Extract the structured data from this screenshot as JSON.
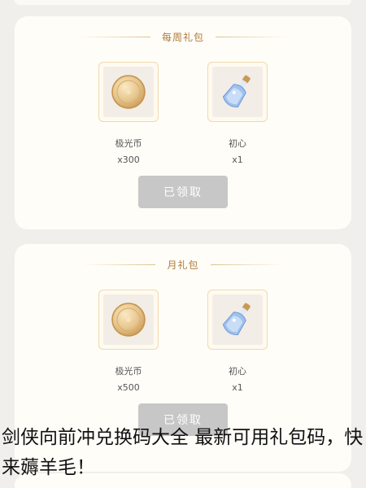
{
  "colors": {
    "background": "#f1efec",
    "card": "#fffdf8",
    "title_gold": "#b07a3a",
    "button_disabled": "#c7c7c7",
    "frame_border": "#efd9b0"
  },
  "cards": [
    {
      "title": "每周礼包",
      "items": [
        {
          "icon": "coin-icon",
          "name": "极光币",
          "qty": "x300"
        },
        {
          "icon": "potion-bottle-icon",
          "name": "初心",
          "qty": "x1"
        }
      ],
      "button_label": "已领取"
    },
    {
      "title": "月礼包",
      "items": [
        {
          "icon": "coin-icon",
          "name": "极光币",
          "qty": "x500"
        },
        {
          "icon": "potion-bottle-icon",
          "name": "初心",
          "qty": "x1"
        }
      ],
      "button_label": "已领取"
    }
  ],
  "caption": "剑侠向前冲兑换码大全 最新可用礼包码，快来薅羊毛！"
}
